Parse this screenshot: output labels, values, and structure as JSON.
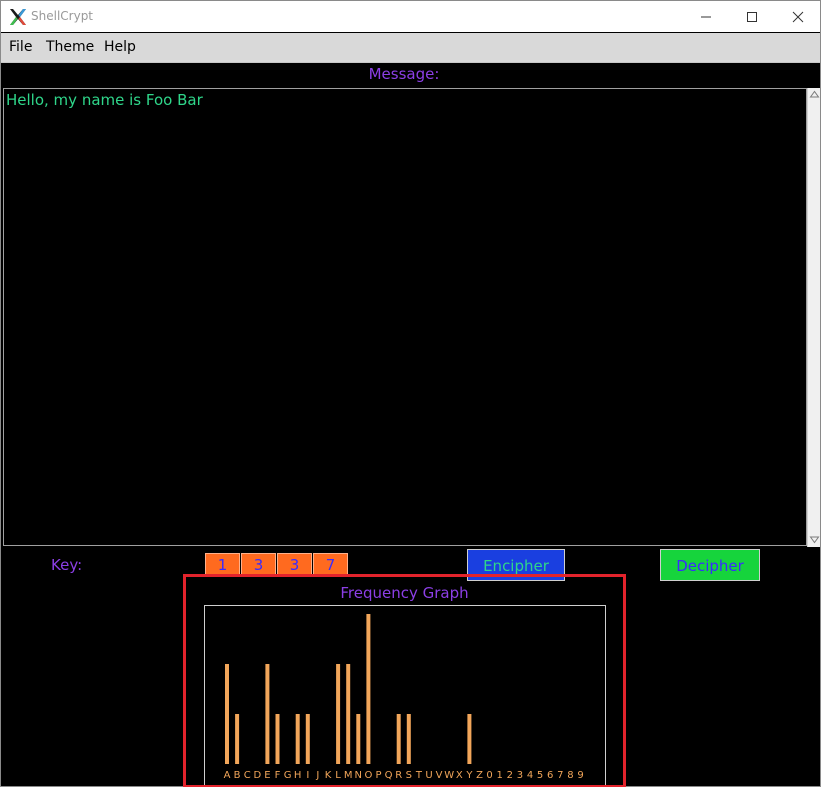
{
  "window": {
    "title": "ShellCrypt",
    "app_icon": "x-logo-icon",
    "controls": [
      "minimize-icon",
      "maximize-icon",
      "close-icon"
    ]
  },
  "menu": {
    "file": "File",
    "theme": "Theme",
    "help": "Help"
  },
  "message": {
    "label": "Message:",
    "text": "Hello, my name is Foo Bar"
  },
  "key": {
    "label": "Key:",
    "digits": [
      "1",
      "3",
      "3",
      "7"
    ]
  },
  "buttons": {
    "encipher": "Encipher",
    "decipher": "Decipher"
  },
  "frequency": {
    "title": "Frequency Graph"
  },
  "colors": {
    "accent_label": "#8c3fe6",
    "message_text": "#2fd68a",
    "key_cell": "#ff6a1f",
    "encipher_bg": "#1a3fe0",
    "decipher_bg": "#16d43c",
    "bars": "#f2a65a",
    "highlight": "#e3232c"
  },
  "chart_data": {
    "type": "bar",
    "title": "Frequency Graph",
    "categories": [
      "A",
      "B",
      "C",
      "D",
      "E",
      "F",
      "G",
      "H",
      "I",
      "J",
      "K",
      "L",
      "M",
      "N",
      "O",
      "P",
      "Q",
      "R",
      "S",
      "T",
      "U",
      "V",
      "W",
      "X",
      "Y",
      "Z",
      "0",
      "1",
      "2",
      "3",
      "4",
      "5",
      "6",
      "7",
      "8",
      "9"
    ],
    "values": [
      2,
      1,
      0,
      0,
      2,
      1,
      0,
      1,
      1,
      0,
      0,
      2,
      2,
      1,
      3,
      0,
      0,
      1,
      1,
      0,
      0,
      0,
      0,
      0,
      1,
      0,
      0,
      0,
      0,
      0,
      0,
      0,
      0,
      0,
      0,
      0
    ],
    "ylim": [
      0,
      3
    ],
    "xlabel": "",
    "ylabel": "",
    "grid": false,
    "legend": "none"
  }
}
